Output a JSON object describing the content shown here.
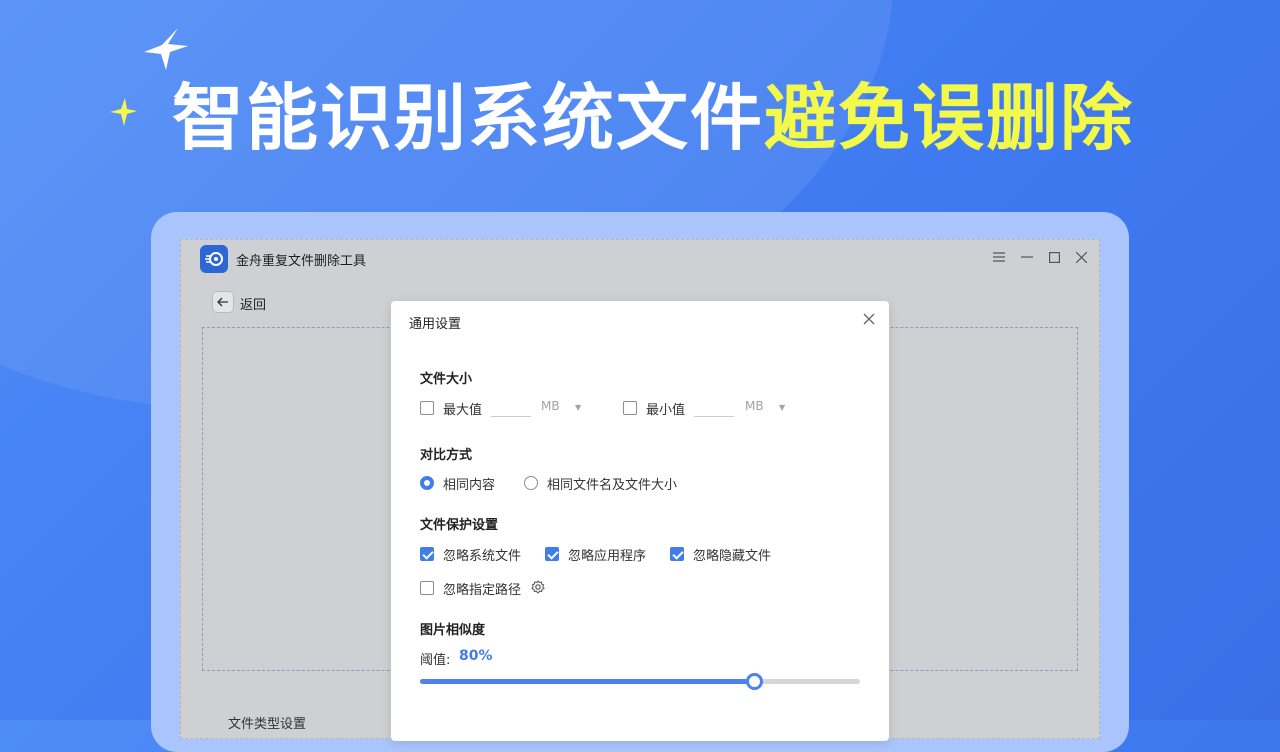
{
  "headline": {
    "white_text": "智能识别系统文件",
    "highlight_text": "避免误删除",
    "highlight_color": "#f3f94a"
  },
  "app": {
    "title": "金舟重复文件删除工具",
    "window_buttons": [
      "menu-icon",
      "minimize-icon",
      "maximize-icon",
      "close-icon"
    ],
    "back_label": "返回",
    "behind_section_label": "文件类型设置"
  },
  "dialog": {
    "title": "通用设置",
    "file_size": {
      "heading": "文件大小",
      "max": {
        "label": "最大值",
        "checked": false,
        "value": "",
        "unit": "MB"
      },
      "min": {
        "label": "最小值",
        "checked": false,
        "value": "",
        "unit": "MB"
      }
    },
    "compare": {
      "heading": "对比方式",
      "options": [
        {
          "label": "相同内容",
          "selected": true
        },
        {
          "label": "相同文件名及文件大小",
          "selected": false
        }
      ]
    },
    "protection": {
      "heading": "文件保护设置",
      "options": [
        {
          "label": "忽略系统文件",
          "checked": true
        },
        {
          "label": "忽略应用程序",
          "checked": true
        },
        {
          "label": "忽略隐藏文件",
          "checked": true
        },
        {
          "label": "忽略指定路径",
          "checked": false
        }
      ]
    },
    "similarity": {
      "heading": "图片相似度",
      "threshold_label": "阈值:",
      "threshold_value": "80%",
      "level": 0.76
    }
  },
  "colors": {
    "accent": "#3f7ee8",
    "background": "#4383f5",
    "frame": "#a9c5fb"
  }
}
